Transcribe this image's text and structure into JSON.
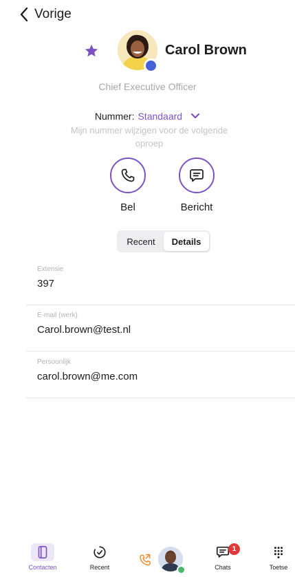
{
  "nav": {
    "back_label": "Vorige",
    "back_icon": "chevron-left-icon"
  },
  "contact": {
    "name": "Carol Brown",
    "job_title": "Chief Executive Officer",
    "favorite_icon": "star-icon",
    "favorite_color": "#7b52c4",
    "presence_color": "#4660d8"
  },
  "number": {
    "label": "Nummer:",
    "value": "Standaard",
    "hint": "Mijn nummer wijzigen voor de volgende oproep"
  },
  "actions": [
    {
      "label": "Bel",
      "icon": "phone-icon"
    },
    {
      "label": "Bericht",
      "icon": "message-icon"
    }
  ],
  "segments": {
    "recent": "Recent",
    "details": "Details",
    "active": "Details"
  },
  "details": [
    {
      "label": "Extensie",
      "value": "397"
    },
    {
      "label": "E-mail (werk)",
      "value": "Carol.brown@test.nl"
    },
    {
      "label": "Persoonlijk",
      "value": "carol.brown@me.com"
    }
  ],
  "tabbar": {
    "contacts": "Contacten",
    "recent": "Recent",
    "chats": "Chats",
    "chats_badge": "1",
    "keypad": "Toetse"
  },
  "colors": {
    "accent": "#7b52c4",
    "badge": "#e0393a",
    "call_orange": "#f08a2e",
    "online": "#4ab86b"
  }
}
